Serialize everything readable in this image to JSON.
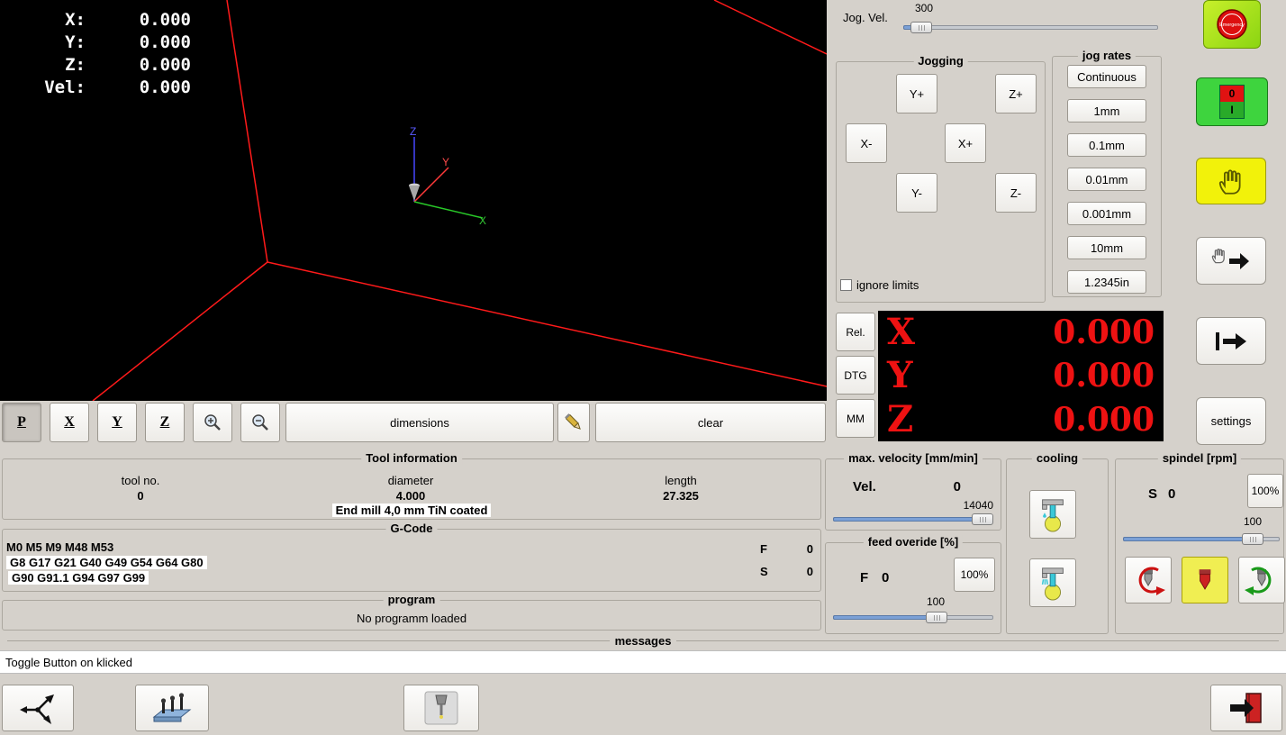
{
  "colors": {
    "dro_red": "#ee1212",
    "preview_line_red": "#ff0000",
    "estop_green": "#9add1c",
    "power_green": "#3ed43e",
    "hand_yellow": "#f2f20a",
    "spindle_active_yellow": "#f0ee52",
    "slider_fill_blue": "#7ba0d6"
  },
  "preview": {
    "readout": [
      {
        "label": "X:",
        "value": "0.000"
      },
      {
        "label": "Y:",
        "value": "0.000"
      },
      {
        "label": "Z:",
        "value": "0.000"
      },
      {
        "label": "Vel:",
        "value": "0.000"
      }
    ],
    "axis_x": "X",
    "axis_y": "Y",
    "axis_z": "Z"
  },
  "toolbar": {
    "perspective": "P",
    "view_x": "X",
    "view_y": "Y",
    "view_z": "Z",
    "dimensions": "dimensions",
    "clear": "clear"
  },
  "jog": {
    "vel_label": "Jog. Vel.",
    "vel_value": "300",
    "frame_label": "Jogging",
    "buttons": [
      "Y+",
      "Z+",
      "X-",
      "X+",
      "Y-",
      "Z-"
    ],
    "ignore_limits_label": "ignore limits",
    "rates_frame_label": "jog rates",
    "rates": [
      "Continuous",
      "1mm",
      "0.1mm",
      "0.01mm",
      "0.001mm",
      "10mm",
      "1.2345in"
    ]
  },
  "dro": {
    "modes": [
      "Rel.",
      "DTG",
      "MM"
    ],
    "rows": [
      {
        "axis": "X",
        "value": "0.000"
      },
      {
        "axis": "Y",
        "value": "0.000"
      },
      {
        "axis": "Z",
        "value": "0.000"
      }
    ]
  },
  "side": {
    "estop_text": "Emergency",
    "power_zero": "0",
    "power_one": "I",
    "settings_label": "settings"
  },
  "tool_info": {
    "title": "Tool information",
    "tool_no_label": "tool no.",
    "tool_no": "0",
    "diameter_label": "diameter",
    "diameter": "4.000",
    "length_label": "length",
    "length": "27.325",
    "description": "End mill 4,0 mm TiN coated"
  },
  "gcode": {
    "title": "G-Code",
    "lines": [
      "M0 M5 M9 M48 M53",
      "G8 G17 G21 G40 G49 G54 G64 G80",
      "G90 G91.1 G94 G97 G99"
    ],
    "f_label": "F",
    "f_value": "0",
    "s_label": "S",
    "s_value": "0"
  },
  "program": {
    "title": "program",
    "status": "No programm loaded"
  },
  "messages": {
    "title": "messages",
    "text": "Toggle Button on klicked"
  },
  "velocity": {
    "title": "max. velocity [mm/min]",
    "vel_label": "Vel.",
    "vel_value": "0",
    "max_value": "14040"
  },
  "feed": {
    "title": "feed overide [%]",
    "f_label": "F",
    "f_value": "0",
    "percent": "100%",
    "slider_value": "100"
  },
  "cooling": {
    "title": "cooling"
  },
  "spindle": {
    "title": "spindel [rpm]",
    "s_label": "S",
    "s_value": "0",
    "percent": "100%",
    "slider_value": "100"
  }
}
